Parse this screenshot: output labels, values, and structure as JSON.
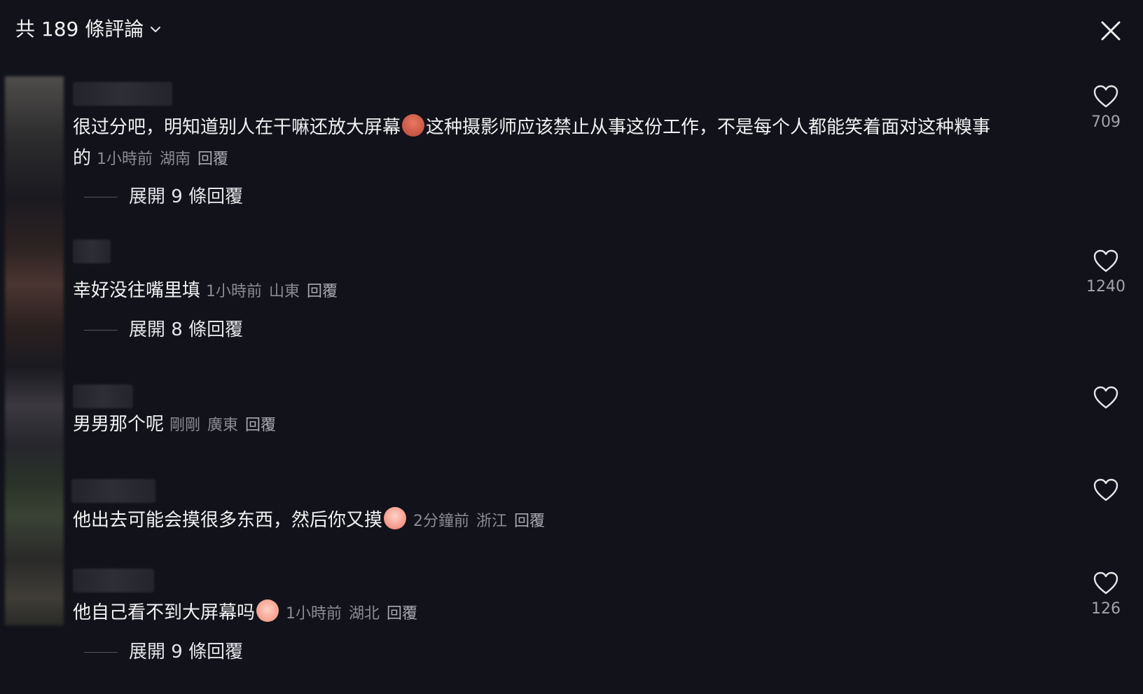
{
  "header": {
    "title": "共 189 條評論",
    "dropdown_icon": "chevron-down-icon",
    "close_icon": "close-icon"
  },
  "comments": [
    {
      "lines": [
        "很过分吧，明知道别人在干嘛还放大屏幕",
        "这种摄影师应该禁止从事这份工作，不是每个人都能笑着面对这种糗事",
        "的"
      ],
      "emoji": "angry-face-emoji",
      "time": "1小時前",
      "location": "湖南",
      "reply": "回覆",
      "likes": "709",
      "expand": "展開 9 條回覆"
    },
    {
      "lines": [
        "幸好没往嘴里填"
      ],
      "time": "1小時前",
      "location": "山東",
      "reply": "回覆",
      "likes": "1240",
      "expand": "展開 8 條回覆"
    },
    {
      "lines": [
        "男男那个呢"
      ],
      "time": "剛剛",
      "location": "廣東",
      "reply": "回覆",
      "likes": ""
    },
    {
      "lines": [
        "他出去可能会摸很多东西，然后你又摸"
      ],
      "emoji": "shocked-face-emoji",
      "time": "2分鐘前",
      "location": "浙江",
      "reply": "回覆",
      "likes": ""
    },
    {
      "lines": [
        "他自己看不到大屏幕吗"
      ],
      "emoji": "crying-face-emoji",
      "time": "1小時前",
      "location": "湖北",
      "reply": "回覆",
      "likes": "126",
      "expand": "展開 9 條回覆"
    }
  ],
  "colors": {
    "background": "#12131a",
    "text": "#f1f1f2",
    "meta": "#8b8c92"
  }
}
